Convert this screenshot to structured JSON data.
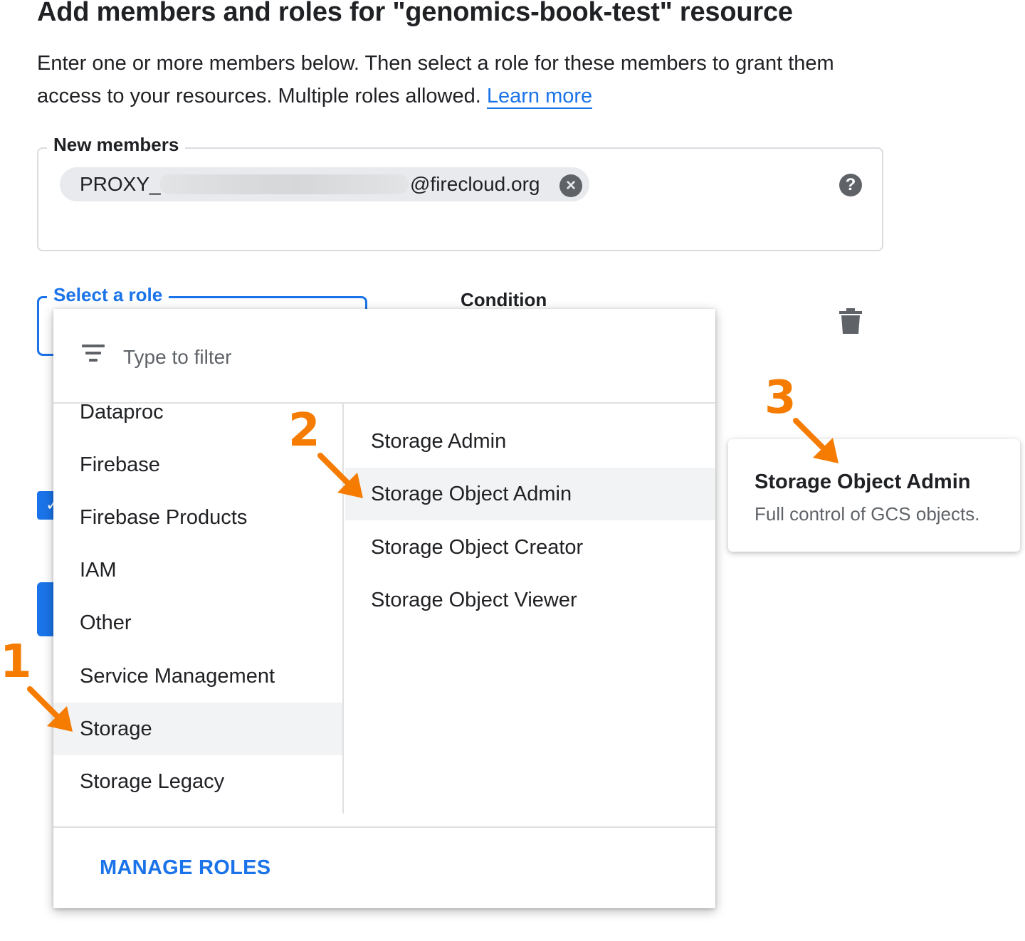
{
  "header": {
    "title": "Add members and roles for \"genomics-book-test\" resource",
    "description": "Enter one or more members below. Then select a role for these members to grant them access to your resources. Multiple roles allowed.",
    "learn_more": "Learn more"
  },
  "members": {
    "label": "New members",
    "chip_prefix": "PROXY_",
    "chip_suffix": "@firecloud.org",
    "remove_icon": "close-circle-icon",
    "help_icon": "help-icon"
  },
  "role": {
    "label": "Select a role",
    "condition_label": "Condition",
    "delete_icon": "trash-icon"
  },
  "dropdown": {
    "filter_placeholder": "Type to filter",
    "categories": [
      "Dataproc",
      "Firebase",
      "Firebase Products",
      "IAM",
      "Other",
      "Service Management",
      "Storage",
      "Storage Legacy"
    ],
    "selected_category": "Storage",
    "roles": [
      "Storage Admin",
      "Storage Object Admin",
      "Storage Object Creator",
      "Storage Object Viewer"
    ],
    "highlighted_role": "Storage Object Admin",
    "manage_roles": "MANAGE ROLES"
  },
  "tooltip": {
    "title": "Storage Object Admin",
    "description": "Full control of GCS objects."
  },
  "annotations": {
    "step1": "1",
    "step2": "2",
    "step3": "3",
    "color": "#f57c00"
  }
}
